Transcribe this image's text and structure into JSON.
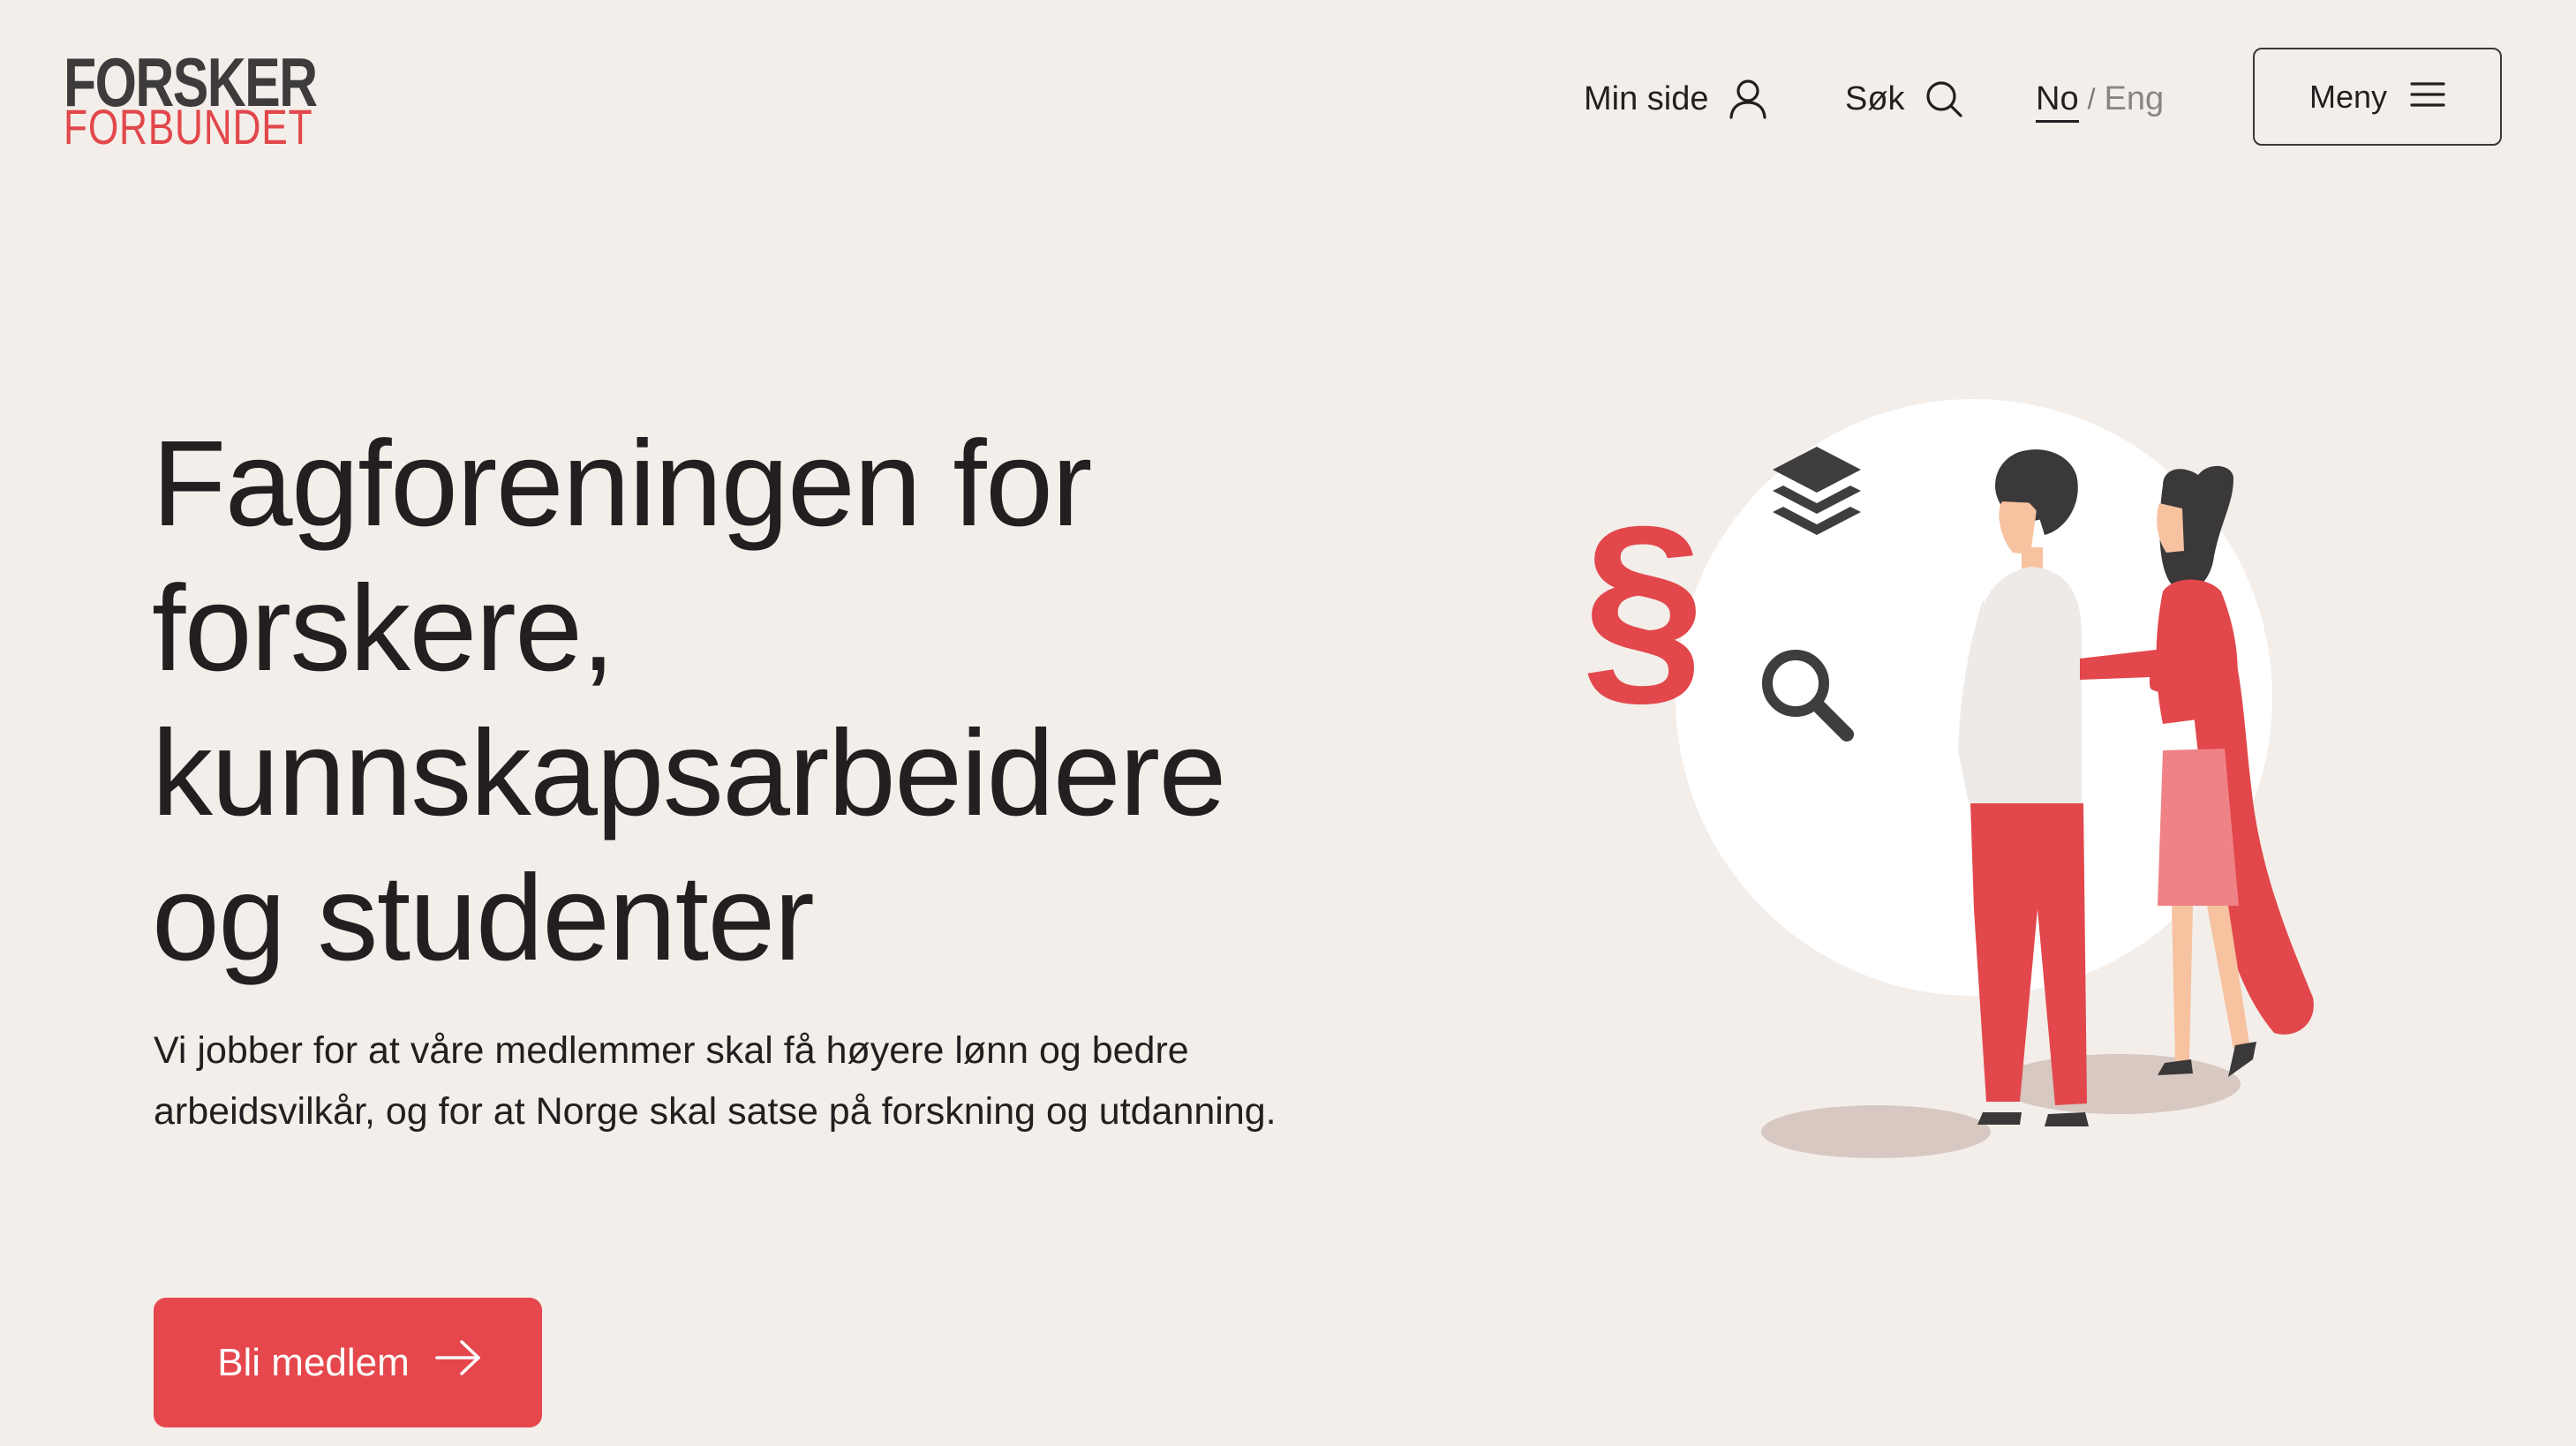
{
  "brand": {
    "logo_top": "FORSKER",
    "logo_bottom": "FORBUNDET"
  },
  "header": {
    "my_page_label": "Min side",
    "my_page_icon": "user-icon",
    "search_label": "Søk",
    "search_icon": "search-icon",
    "language": {
      "selected": "No",
      "separator": "/",
      "other": "Eng"
    },
    "menu_label": "Meny",
    "menu_icon": "hamburger-icon"
  },
  "hero": {
    "title": "Fagforeningen for forskere, kunnskapsarbeidere og studenter",
    "lead": "Vi jobber for at våre medlemmer skal få høyere lønn og bedre arbeidsvilkår, og for at Norge skal satse på forskning og utdanning.",
    "cta_label": "Bli medlem",
    "cta_icon": "arrow-right-icon"
  },
  "illustration": {
    "paragraph_symbol": "§",
    "icons": [
      "paragraph-icon",
      "layers-icon",
      "magnifier-icon"
    ]
  },
  "colors": {
    "background": "#f3eeea",
    "accent": "#e5474c",
    "text": "#231f20",
    "muted": "#8a8584"
  }
}
